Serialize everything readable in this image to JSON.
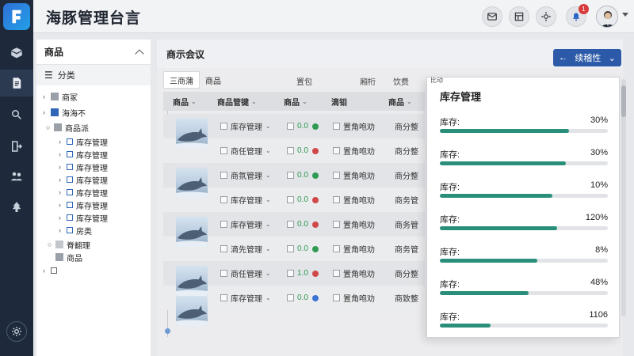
{
  "app": {
    "title": "海豚管理台言"
  },
  "header": {
    "notification_count": "1",
    "icons": [
      "mail-icon",
      "layout-icon",
      "settings-icon",
      "notification-icon"
    ]
  },
  "sidebar": {
    "icons": [
      "box-icon",
      "document-icon",
      "search-user-icon",
      "export-icon",
      "users-icon",
      "tree-icon"
    ],
    "settings_icon": "gear-icon"
  },
  "category_panel": {
    "title": "商品",
    "subheader": "分类",
    "tree": [
      {
        "label": "商冢"
      },
      {
        "label": "海海不"
      },
      {
        "label": "商品派"
      },
      {
        "label": "库存管理"
      },
      {
        "label": "库存管理"
      },
      {
        "label": "库存管理"
      },
      {
        "label": "库存管理"
      },
      {
        "label": "库存管理"
      },
      {
        "label": "库存管理"
      },
      {
        "label": "库存管理"
      },
      {
        "label": "房类"
      },
      {
        "label": "脊翻理"
      },
      {
        "label": "商品"
      },
      {
        "label": ""
      }
    ]
  },
  "main": {
    "title": "商示会议",
    "primary_button": "续稽性",
    "tabs": [
      "三商蒲",
      "商品"
    ],
    "column_labels": [
      "置包",
      "厢桁",
      "饮费"
    ],
    "table": {
      "headers": [
        "商品",
        "商品管键",
        "商品",
        "滴钼",
        "商品"
      ],
      "rows": [
        {
          "name": "库存管理",
          "value": "0.0",
          "status": "green",
          "c1": "置角咆劝",
          "c2": "商分整"
        },
        {
          "name": "商任管理",
          "value": "0.0",
          "status": "red",
          "c1": "置角咆劝",
          "c2": "商分整"
        },
        {
          "name": "商氛管理",
          "value": "0.0",
          "status": "green",
          "c1": "置角咆劝",
          "c2": "商分整"
        },
        {
          "name": "库存管理",
          "value": "0.0",
          "status": "red",
          "c1": "置角咆劝",
          "c2": "商务管"
        },
        {
          "name": "库存管理",
          "value": "0.0",
          "status": "red",
          "c1": "置角咆劝",
          "c2": "商务管"
        },
        {
          "name": "滴先管理",
          "value": "0.0",
          "status": "green",
          "c1": "置角咆劝",
          "c2": "商务管"
        },
        {
          "name": "商任管理",
          "value": "1.0",
          "status": "red",
          "c1": "置角咆劝",
          "c2": "商分整"
        },
        {
          "name": "库存管理",
          "value": "0.0",
          "status": "blue",
          "c1": "置角咆劝",
          "c2": "商致整"
        }
      ]
    }
  },
  "inventory": {
    "top_label": "比动",
    "title": "库存管理",
    "items": [
      {
        "label": "库存:",
        "value": "30%",
        "fill": 0.77
      },
      {
        "label": "库存:",
        "value": "30%",
        "fill": 0.75
      },
      {
        "label": "库存:",
        "value": "10%",
        "fill": 0.67
      },
      {
        "label": "库存:",
        "value": "120%",
        "fill": 0.7
      },
      {
        "label": "库存:",
        "value": "8%",
        "fill": 0.58
      },
      {
        "label": "库存:",
        "value": "48%",
        "fill": 0.53
      },
      {
        "label": "库存:",
        "value": "1106",
        "fill": 0.3
      }
    ]
  },
  "colors": {
    "green": "#2e9a52",
    "red": "#d14848",
    "blue": "#3b73d4",
    "fill": "#2a8f7a",
    "brand": "#2c5aa8"
  }
}
